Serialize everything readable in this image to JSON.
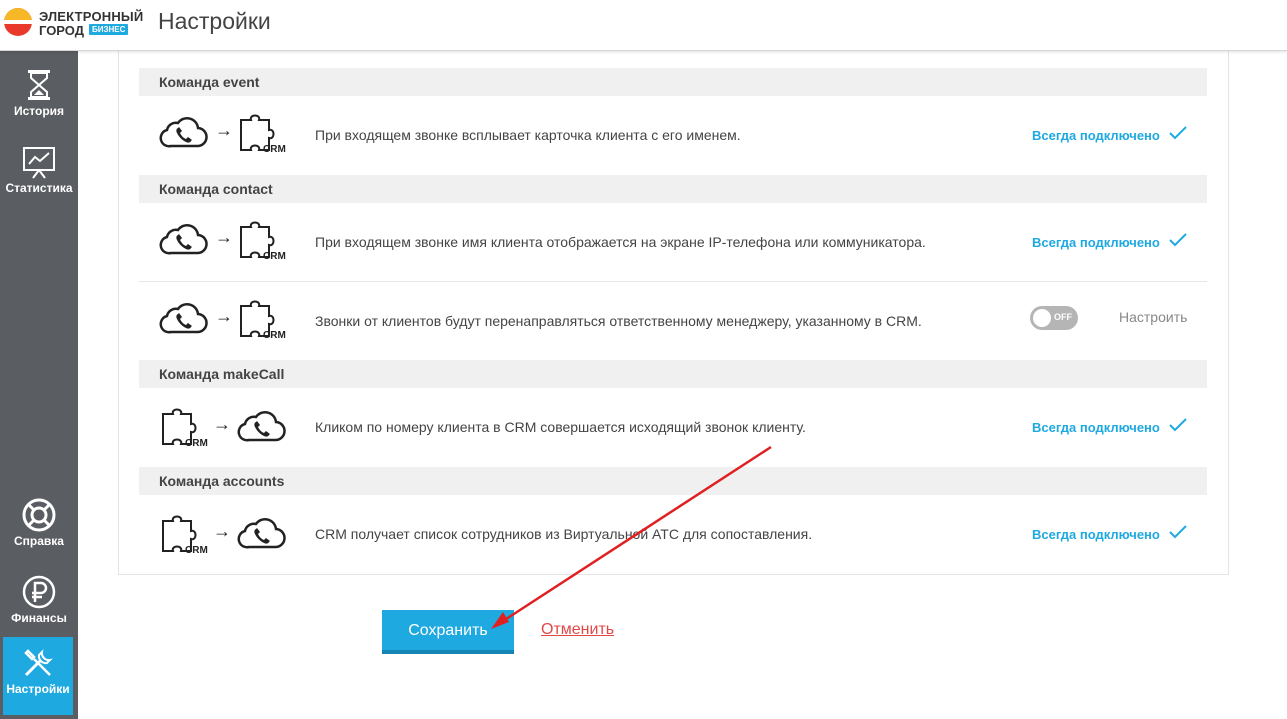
{
  "header": {
    "logo_line1": "ЭЛЕКТРОННЫЙ",
    "logo_line2": "ГОРОД",
    "logo_badge": "БИЗНЕС",
    "title": "Настройки"
  },
  "sidebar": {
    "items": [
      {
        "label": "История",
        "icon": "hourglass-icon"
      },
      {
        "label": "Статистика",
        "icon": "chart-board-icon"
      },
      {
        "label": "Справка",
        "icon": "lifebuoy-icon"
      },
      {
        "label": "Финансы",
        "icon": "ruble-icon"
      },
      {
        "label": "Настройки",
        "icon": "tools-icon",
        "active": true
      }
    ]
  },
  "sections": [
    {
      "title": "Команда event",
      "rows": [
        {
          "direction": "phone-to-crm",
          "desc": "При входящем звонке всплывает карточка клиента с его именем.",
          "status": "Всегда подключено"
        }
      ]
    },
    {
      "title": "Команда contact",
      "rows": [
        {
          "direction": "phone-to-crm",
          "desc": "При входящем звонке имя клиента отображается на экране IP-телефона или коммуникатора.",
          "status": "Всегда подключено"
        },
        {
          "direction": "phone-to-crm",
          "desc": "Звонки от клиентов будут перенаправляться ответственному менеджеру, указанному в CRM.",
          "toggle_label": "OFF",
          "toggle_on": false,
          "configure": "Настроить"
        }
      ]
    },
    {
      "title": "Команда makeCall",
      "rows": [
        {
          "direction": "crm-to-phone",
          "desc": "Кликом по номеру клиента в CRM совершается исходящий звонок клиенту.",
          "status": "Всегда подключено"
        }
      ]
    },
    {
      "title": "Команда accounts",
      "rows": [
        {
          "direction": "crm-to-phone",
          "desc": "CRM получает список сотрудников из Виртуальной АТС для сопоставления.",
          "status": "Всегда подключено"
        }
      ]
    }
  ],
  "crm_label": "CRM",
  "actions": {
    "save": "Сохранить",
    "cancel": "Отменить"
  },
  "colors": {
    "accent": "#1fa9e1",
    "sidebar": "#5a5d61",
    "cancel": "#e04848",
    "annotation_arrow": "#e02020"
  }
}
